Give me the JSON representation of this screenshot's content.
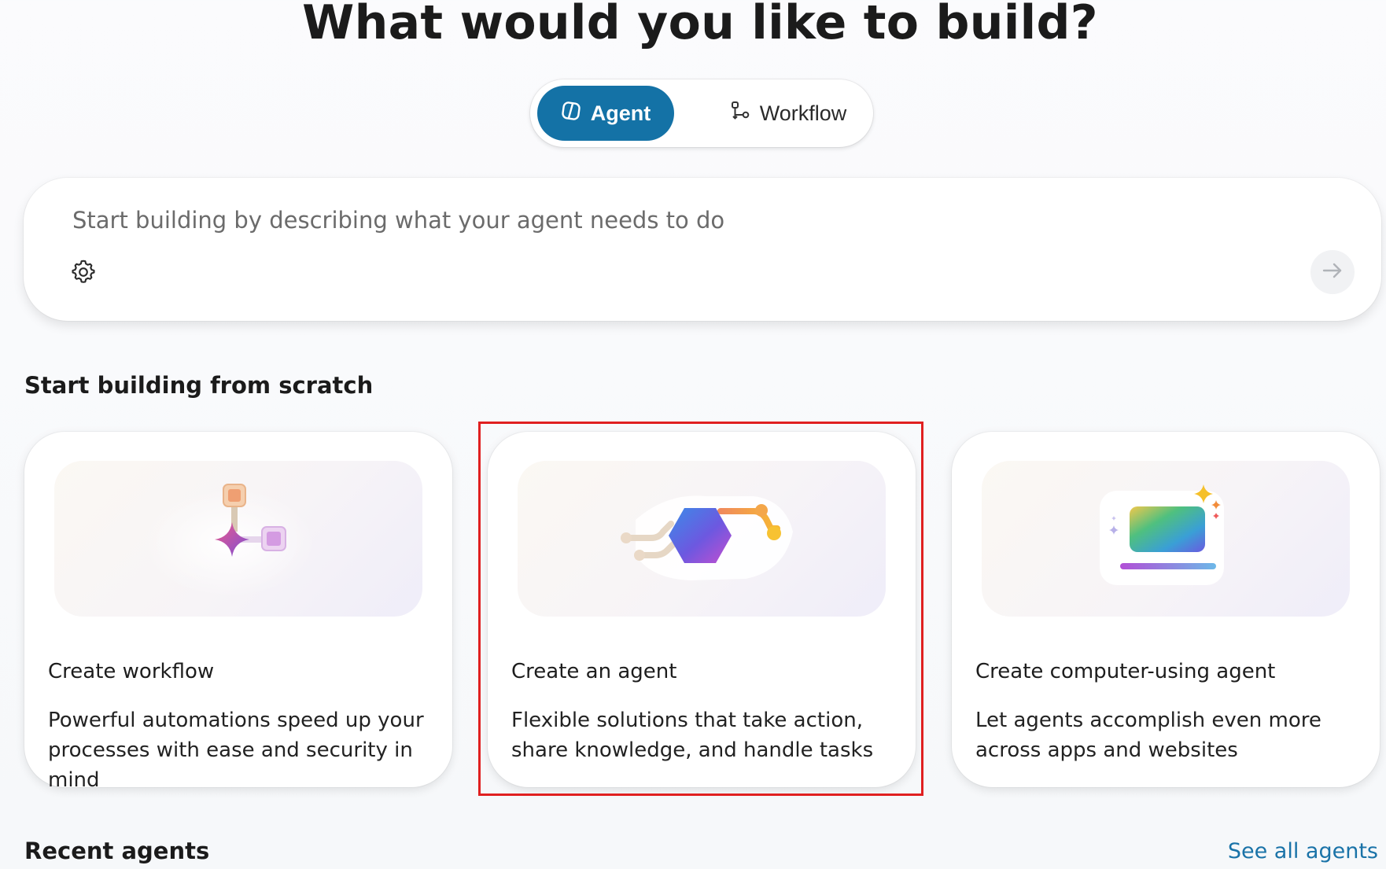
{
  "page": {
    "title": "What would you like to build?"
  },
  "mode_toggle": {
    "agent_label": "Agent",
    "workflow_label": "Workflow",
    "selected": "Agent"
  },
  "prompt": {
    "placeholder": "Start building by describing what your agent needs to do",
    "value": ""
  },
  "scratch_section": {
    "heading": "Start building from scratch",
    "cards": [
      {
        "title": "Create workflow",
        "description": "Powerful automations speed up your processes with ease and security in mind",
        "icon": "workflow-illustration-icon"
      },
      {
        "title": "Create an agent",
        "description": "Flexible solutions that take action, share knowledge, and handle tasks",
        "icon": "agent-illustration-icon",
        "highlighted": true
      },
      {
        "title": "Create computer-using agent",
        "description": "Let agents accomplish even more across apps and websites",
        "icon": "computer-agent-illustration-icon"
      }
    ]
  },
  "recent_section": {
    "heading": "Recent agents",
    "see_all_label": "See all agents"
  },
  "colors": {
    "accent": "#1472a6",
    "link": "#1a73a8",
    "highlight_border": "#e02020"
  }
}
